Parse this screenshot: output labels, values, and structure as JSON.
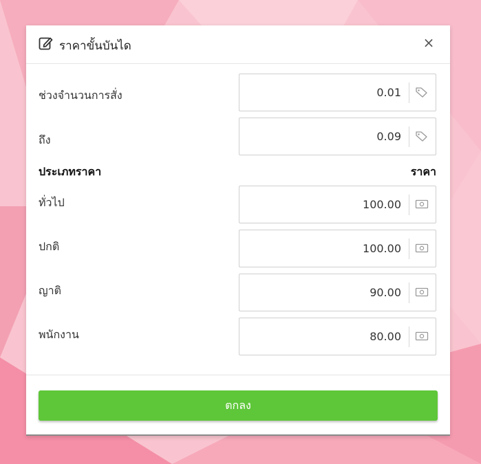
{
  "dialog": {
    "title": "ราคาขั้นบันได",
    "close_symbol": "×",
    "icon": "edit-icon"
  },
  "range": {
    "from_label": "ช่วงจำนวนการสั่ง",
    "from_value": "0.01",
    "to_label": "ถึง",
    "to_value": "0.09",
    "icon": "tag-icon"
  },
  "prices": {
    "type_header": "ประเภทราคา",
    "price_header": "ราคา",
    "icon": "money-icon",
    "items": [
      {
        "label": "ทั่วไป",
        "value": "100.00"
      },
      {
        "label": "ปกติ",
        "value": "100.00"
      },
      {
        "label": "ญาติ",
        "value": "90.00"
      },
      {
        "label": "พนักงาน",
        "value": "80.00"
      }
    ]
  },
  "footer": {
    "ok_label": "ตกลง"
  },
  "colors": {
    "accent": "#5ec639",
    "background": "#f9bcc8"
  }
}
